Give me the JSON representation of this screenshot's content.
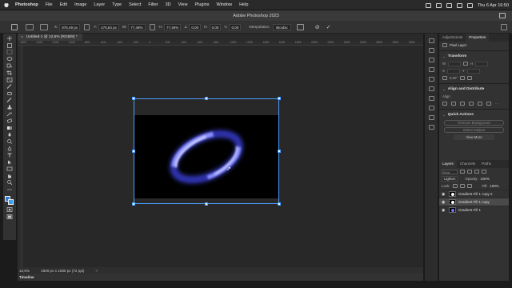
{
  "menubar": {
    "app": "Photoshop",
    "items": [
      "File",
      "Edit",
      "Image",
      "Layer",
      "Type",
      "Select",
      "Filter",
      "3D",
      "View",
      "Plugins",
      "Window",
      "Help"
    ],
    "clock": "Thu 6 Apr  16:50"
  },
  "window": {
    "title": "Adobe Photoshop 2023"
  },
  "options": {
    "x_label": "X:",
    "x_value": "975,49 px",
    "y_label": "Y:",
    "y_value": "475,84 px",
    "w_label": "W:",
    "w_value": "77,48%",
    "h_label": "H:",
    "h_value": "77,48%",
    "angle_value": "0,00",
    "hskew_label": "H:",
    "hskew_value": "0,00",
    "vskew_label": "V:",
    "vskew_value": "0,00",
    "interp_label": "Interpolation:",
    "interp_value": "Bicubic",
    "cancel": "⊘",
    "commit": "✓"
  },
  "document": {
    "tab": "Untitled-1 @ 12,5% (RGB/8) *",
    "close": "×"
  },
  "ruler": {
    "labels": [
      "-1600",
      "-1400",
      "-1200",
      "-1000",
      "-800",
      "-600",
      "-400",
      "-200",
      "0",
      "200",
      "400",
      "600",
      "800",
      "1000",
      "1200",
      "1400",
      "1600",
      "1800",
      "2000",
      "2200",
      "2400",
      "2600",
      "2800",
      "3000",
      "3200"
    ]
  },
  "status": {
    "zoom": "12,5%",
    "dims": "1920 px x 1080 px (72 ppi)",
    "arrow": ">"
  },
  "timeline": {
    "label": "Timeline"
  },
  "properties": {
    "tabs": [
      "Adjustments",
      "Properties"
    ],
    "kind": "Pixel Layer",
    "transform": "Transform",
    "align": "Align and Distribute",
    "align_sub": "Align:",
    "quick": "Quick Actions",
    "btn1": "Remove Background",
    "btn2": "Select Subject",
    "btn3": "View More",
    "w_label": "W",
    "h_label": "H",
    "x_label": "X",
    "y_label": "Y",
    "deg": "0,00°"
  },
  "layers": {
    "tabs": [
      "Layers",
      "Channels",
      "Paths"
    ],
    "search": "Kind",
    "blend": "Lighten",
    "opacity_label": "Opacity:",
    "opacity_value": "100%",
    "lock_label": "Lock:",
    "fill_label": "Fill:",
    "fill_value": "100%",
    "items": [
      {
        "name": "Gradient Fill 1 copy 2",
        "selected": false
      },
      {
        "name": "Gradient Fill 1 copy",
        "selected": true
      },
      {
        "name": "Gradient Fill 1",
        "selected": false
      }
    ]
  },
  "colors": {
    "selection": "#4a9cff",
    "fg": "#2a7bd6",
    "bg": "#3aa0f0",
    "glow": "#6e75ff"
  }
}
